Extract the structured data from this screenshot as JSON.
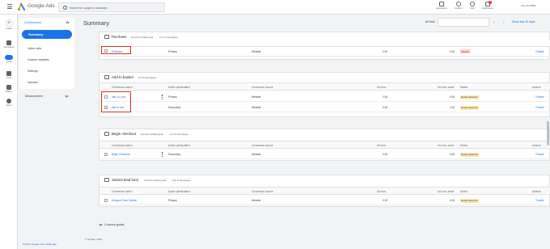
{
  "app": {
    "brand": "Google Ads",
    "search_placeholder": "Search for a page or campaign",
    "account": "491-374-8881"
  },
  "toolbar": {
    "appearance": "Appearance",
    "refresh": "Refresh",
    "help": "Help",
    "notifications": "Notifications",
    "notif_count": "1"
  },
  "nav": [
    {
      "label": "Create"
    },
    {
      "label": "Campaigns"
    },
    {
      "label": "Goals"
    },
    {
      "label": "Tools"
    },
    {
      "label": "Billing"
    },
    {
      "label": "Admin"
    }
  ],
  "sidebar": {
    "section": "Conversions",
    "items": [
      "Summary",
      "Value rules",
      "Custom variables",
      "Settings",
      "Uploads"
    ],
    "measurement": "Measurement"
  },
  "header": {
    "title": "Summary",
    "range_label": "All time",
    "show_last": "Show last 30 days",
    "prev": "‹",
    "next": "›"
  },
  "columns": {
    "action": "Conversion action",
    "optimization": "Action optimization",
    "source": "Conversion source",
    "all_conv": "All conv.",
    "all_conv_value": "All conv. value",
    "status": "Status",
    "actions": "Actions"
  },
  "sections": [
    {
      "title": "Purchase",
      "goal": "Account default goal",
      "count": "0 of 1 campaigns",
      "rows": [
        {
          "name": "Purchase",
          "opt": "Primary",
          "source": "Website",
          "conv": "0.00",
          "value": "0.00",
          "status": "Inactive",
          "status_type": "inactive",
          "action": "Trouble"
        }
      ]
    },
    {
      "title": "Add to basket",
      "goal": "",
      "count": "0 of 8 campaigns",
      "rows": [
        {
          "name": "add_to_cart",
          "opt": "Primary",
          "source": "Website",
          "conv": "0.00",
          "value": "0.00",
          "status": "Needs attention",
          "status_type": "attn",
          "action": "Trouble"
        },
        {
          "name": "add to cart",
          "opt": "Secondary",
          "source": "Website",
          "conv": "0.00",
          "value": "0.00",
          "status": "Needs attention",
          "status_type": "attn",
          "action": "Trouble"
        }
      ]
    },
    {
      "title": "Begin checkout",
      "goal": "Account default goal",
      "count": "0 of 8 campaigns",
      "rows": [
        {
          "name": "Begin Checkout",
          "opt": "Secondary",
          "source": "Website",
          "conv": "0.00",
          "value": "0.00",
          "status": "Needs attention",
          "status_type": "attn",
          "action": "Trouble"
        }
      ]
    },
    {
      "title": "Submit lead form",
      "goal": "Account default goal",
      "count": "0 of 8 campaigns",
      "rows": [
        {
          "name": "Hubspot Form Submit",
          "opt": "Primary",
          "source": "Website",
          "conv": "0.00",
          "value": "0.00",
          "status": "Needs attention",
          "status_type": "attn",
          "action": "Trouble"
        }
      ]
    }
  ],
  "custom_goals": "Custom goals",
  "footer": {
    "copyright": "© Google, 2023.",
    "phone_banner": "Get the Google Ads mobile app"
  },
  "colors": {
    "accent": "#1a73e8",
    "highlight": "#d93025",
    "attention": "#fce8b2",
    "inactive": "#fad2cf"
  }
}
